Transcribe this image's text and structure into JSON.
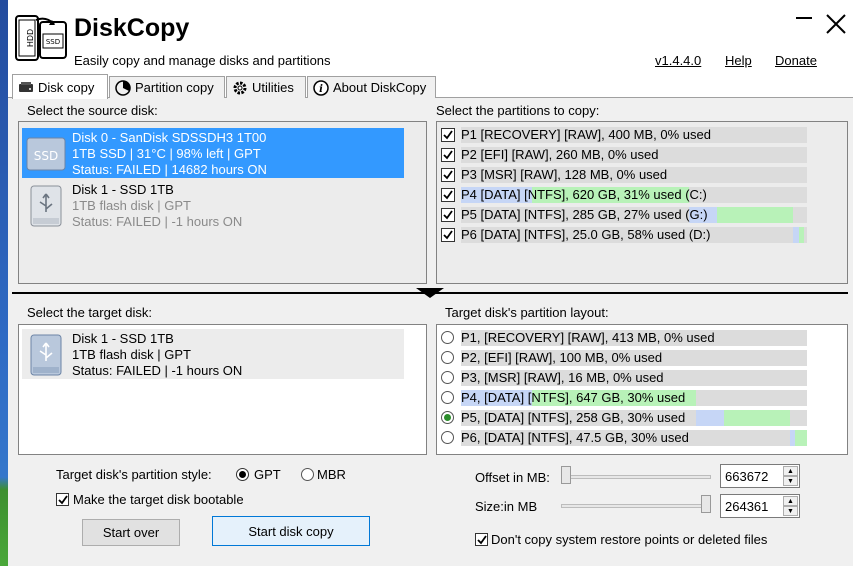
{
  "app": {
    "title": "DiskCopy",
    "subtitle": "Easily copy and manage disks and partitions",
    "version": "v1.4.4.0",
    "help_label": "Help",
    "donate_label": "Donate"
  },
  "tabs": [
    {
      "label": "Disk copy",
      "icon": "disk-icon",
      "active": true
    },
    {
      "label": "Partition copy",
      "icon": "pie-chart-icon",
      "active": false
    },
    {
      "label": "Utilities",
      "icon": "gear-icon",
      "active": false
    },
    {
      "label": "About DiskCopy",
      "icon": "info-icon",
      "active": false
    }
  ],
  "source": {
    "label": "Select the source disk:",
    "disks": [
      {
        "name": "Disk 0 - SanDisk SDSSDH3 1T00",
        "info": "1TB SSD | 31°C | 98% left | GPT",
        "status": "Status: FAILED | 14682 hours ON",
        "icon": "ssd-icon",
        "selected": true
      },
      {
        "name": "Disk 1 - SSD 1TB",
        "info": "1TB flash disk | GPT",
        "status": "Status: FAILED | -1 hours ON",
        "icon": "usb-drive-icon",
        "selected": false
      }
    ]
  },
  "source_partitions": {
    "label": "Select the partitions to copy:",
    "items": [
      {
        "label": "P1 [RECOVERY] [RAW], 400 MB, 0% used",
        "checked": true,
        "size_fraction": 0,
        "used_fraction": 0
      },
      {
        "label": "P2 [EFI] [RAW], 260 MB, 0% used",
        "checked": true,
        "size_fraction": 0,
        "used_fraction": 0
      },
      {
        "label": "P3 [MSR] [RAW], 128 MB, 0% used",
        "checked": true,
        "size_fraction": 0,
        "used_fraction": 0
      },
      {
        "label": "P4 [DATA] [NTFS], 620 GB, 31% used (C:)",
        "checked": true,
        "size_fraction": 0.66,
        "used_fraction": 0.31
      },
      {
        "label": "P5 [DATA] [NTFS], 285 GB, 27% used (G:)",
        "checked": true,
        "size_fraction": 0.3,
        "used_fraction": 0.27
      },
      {
        "label": "P6 [DATA] [NTFS], 25.0 GB, 58% used (D:)",
        "checked": true,
        "size_fraction": 0.03,
        "used_fraction": 0.58
      }
    ]
  },
  "target": {
    "label": "Select the target disk:",
    "disks": [
      {
        "name": "Disk 1 - SSD 1TB",
        "info": "1TB flash disk | GPT",
        "status": "Status: FAILED | -1 hours ON",
        "icon": "usb-drive-icon"
      }
    ]
  },
  "target_layout": {
    "label": "Target disk's partition layout:",
    "items": [
      {
        "label": "P1, [RECOVERY] [RAW], 413 MB, 0% used",
        "selected": false,
        "size_fraction": 0,
        "used_fraction": 0
      },
      {
        "label": "P2, [EFI] [RAW], 100 MB, 0% used",
        "selected": false,
        "size_fraction": 0,
        "used_fraction": 0
      },
      {
        "label": "P3, [MSR] [RAW], 16 MB, 0% used",
        "selected": false,
        "size_fraction": 0,
        "used_fraction": 0
      },
      {
        "label": "P4, [DATA] [NTFS], 647 GB, 30% used",
        "selected": false,
        "size_fraction": 0.68,
        "used_fraction": 0.3
      },
      {
        "label": "P5, [DATA] [NTFS], 258 GB, 30% used",
        "selected": true,
        "size_fraction": 0.27,
        "used_fraction": 0.3
      },
      {
        "label": "P6, [DATA] [NTFS], 47.5 GB, 30% used",
        "selected": false,
        "size_fraction": 0.05,
        "used_fraction": 0.3
      }
    ]
  },
  "options": {
    "partition_style_label": "Target disk's partition style:",
    "gpt_label": "GPT",
    "mbr_label": "MBR",
    "selected_style": "GPT",
    "bootable_label": "Make the target disk bootable",
    "bootable_checked": true,
    "offset_label": "Offset in MB:",
    "offset_value": "663672",
    "offset_slider": 0.0,
    "size_label": "Size:in MB",
    "size_value": "264361",
    "size_slider": 1.0,
    "no_restore_label": "Don't copy system restore points or deleted files",
    "no_restore_checked": true
  },
  "buttons": {
    "start_over": "Start over",
    "start_copy": "Start disk copy"
  },
  "colors": {
    "selection": "#3399ff",
    "used": "#c6d6f6",
    "free": "#b8f2b8",
    "bar_bg": "#dcdcdc"
  }
}
